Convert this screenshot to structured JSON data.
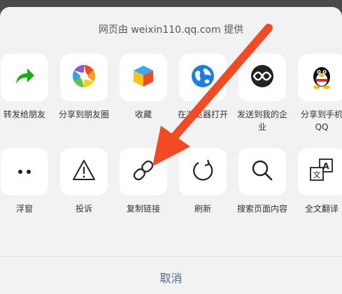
{
  "sheet": {
    "header": "网页由 weixin110.qq.com 提供",
    "row1": [
      {
        "label": "转发给朋友",
        "icon": "forward-arrow-icon"
      },
      {
        "label": "分享到朋友圈",
        "icon": "moments-aperture-icon"
      },
      {
        "label": "收藏",
        "icon": "favorite-cube-icon"
      },
      {
        "label": "在浏览器打开",
        "icon": "browser-globe-icon"
      },
      {
        "label": "发送到我的企业",
        "icon": "wecom-icon"
      },
      {
        "label": "分享到手机QQ",
        "icon": "qq-penguin-icon"
      }
    ],
    "row2": [
      {
        "label": "浮窗",
        "icon": "float-window-icon"
      },
      {
        "label": "投诉",
        "icon": "warning-icon"
      },
      {
        "label": "复制链接",
        "icon": "link-icon"
      },
      {
        "label": "刷新",
        "icon": "refresh-icon"
      },
      {
        "label": "搜索页面内容",
        "icon": "search-icon"
      },
      {
        "label": "全文翻译",
        "icon": "translate-icon"
      }
    ],
    "cancel": "取消"
  },
  "colors": {
    "forward": "#1aad19",
    "globe": "#1e7ee0",
    "arrow": "#f24a22",
    "cancel": "#4a6b8f"
  }
}
